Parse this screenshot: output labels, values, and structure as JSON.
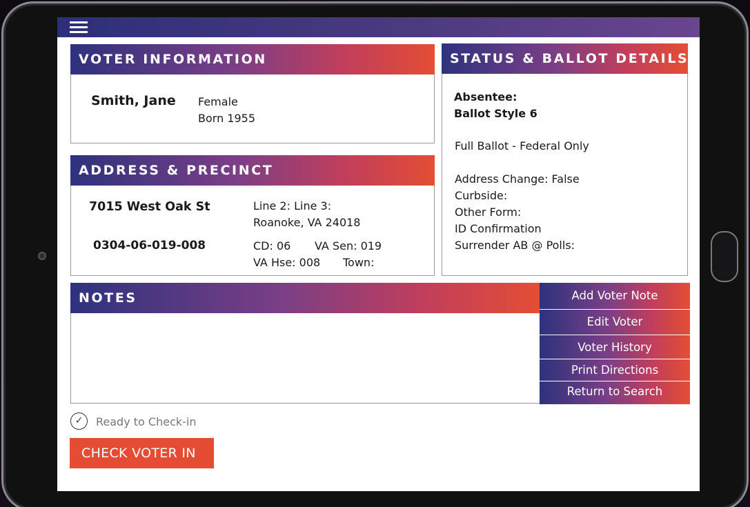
{
  "voter_info": {
    "title": "VOTER  INFORMATION",
    "name": "Smith, Jane",
    "gender": "Female",
    "born": "Born 1955"
  },
  "address": {
    "title": "ADDRESS & PRECINCT",
    "street": "7015 West Oak St",
    "lines": "Line 2:   Line 3:",
    "city": "Roanoke, VA 24018",
    "precinct_id": "0304-06-019-008",
    "cd": "CD: 06",
    "va_sen": "VA Sen: 019",
    "va_hse": "VA Hse: 008",
    "town": "Town:"
  },
  "status": {
    "title": "STATUS & BALLOT DETAILS",
    "absentee": "Absentee:",
    "ballot_style": "Ballot Style 6",
    "full_ballot": "Full Ballot - Federal  Only",
    "address_change": "Address Change: False",
    "curbside": "Curbside:",
    "other_form": "Other Form:",
    "id_confirmation": "ID Confirmation",
    "surrender": "Surrender AB @ Polls:"
  },
  "notes": {
    "title": "NOTES"
  },
  "actions": {
    "add_note": "Add Voter Note",
    "edit": "Edit Voter",
    "history": "Voter History",
    "print": "Print Directions",
    "return": "Return to Search"
  },
  "checkin": {
    "status_text": "Ready to Check-in",
    "button_label": "CHECK VOTER IN"
  },
  "icons": {
    "menu": "hamburger-menu-icon",
    "ready": "check-circle-icon"
  },
  "colors": {
    "accent": "#e44d33",
    "header_start": "#2e327e",
    "header_end": "#e44e34"
  }
}
